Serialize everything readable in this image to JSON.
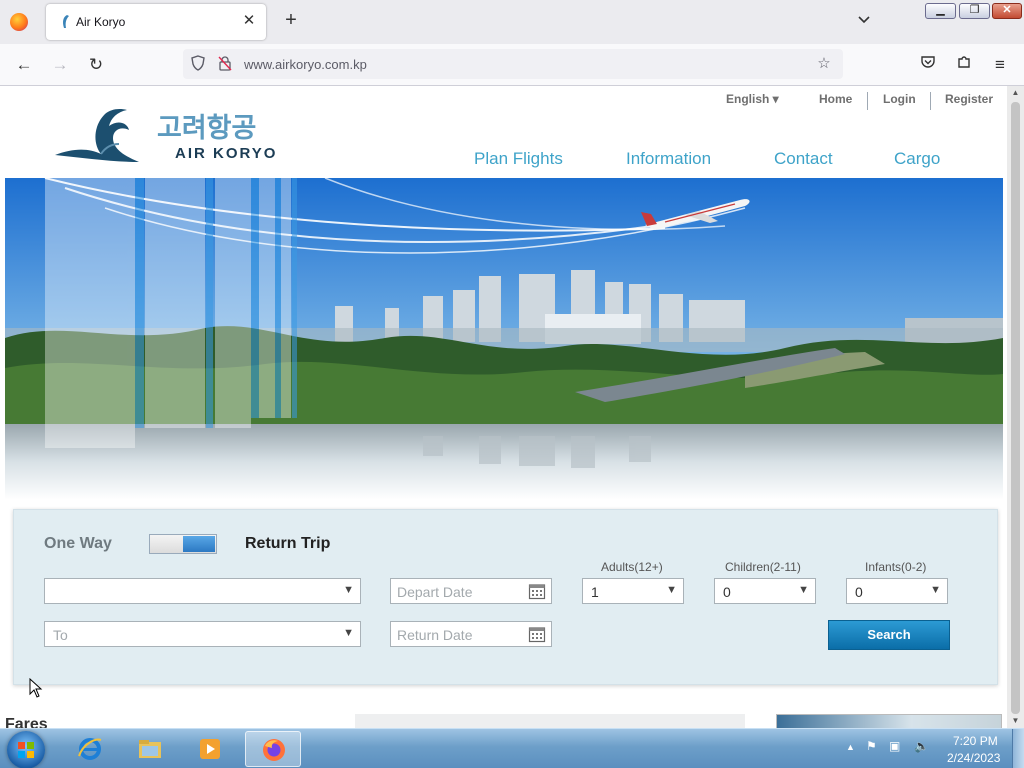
{
  "browser": {
    "tab_title": "Air Koryo",
    "url": "www.airkoryo.com.kp"
  },
  "site": {
    "language": "English ▾",
    "top_links": [
      "Home",
      "Login",
      "Register"
    ],
    "logo_korean": "고려항공",
    "logo_text": "AIR KORYO",
    "nav": [
      "Plan Flights",
      "Information",
      "Contact",
      "Cargo"
    ]
  },
  "search": {
    "one_way": "One Way",
    "return_trip": "Return Trip",
    "from_value": "",
    "to_placeholder": "To",
    "depart_placeholder": "Depart Date",
    "return_placeholder": "Return Date",
    "adults_label": "Adults(12+)",
    "children_label": "Children(2-11)",
    "infants_label": "Infants(0-2)",
    "adults_value": "1",
    "children_value": "0",
    "infants_value": "0",
    "search_button": "Search",
    "trip_type": "return"
  },
  "content": {
    "fares_heading": "Fares"
  },
  "taskbar": {
    "time": "7:20 PM",
    "date": "2/24/2023"
  },
  "colors": {
    "nav_link": "#3ea3c9",
    "search_button": "#1580bf",
    "toggle_active": "#3b8fd6"
  }
}
